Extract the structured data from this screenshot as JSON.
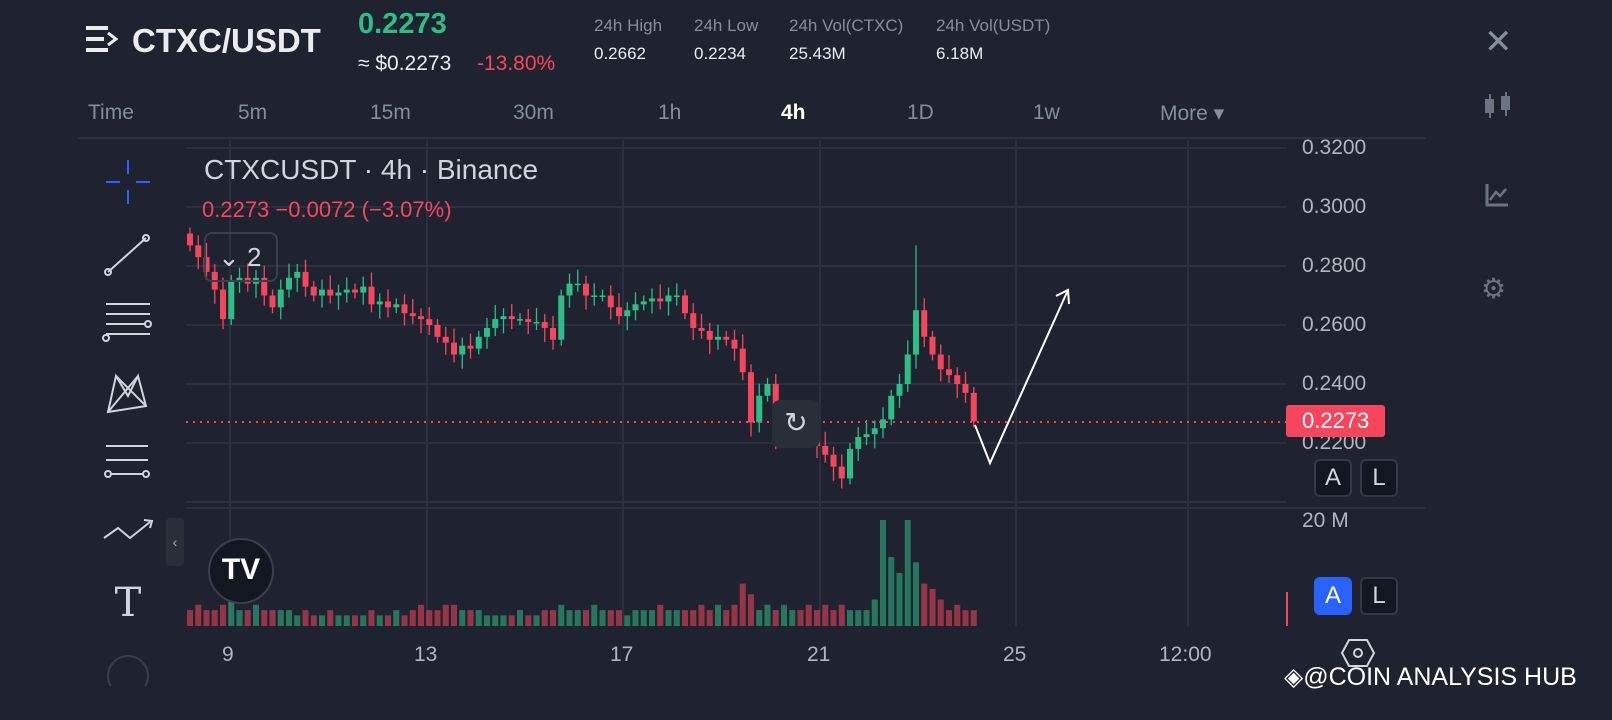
{
  "header": {
    "pair": "CTXC/USDT",
    "last_price": "0.2273",
    "usd_price": "≈ $0.2273",
    "change_pct": "-13.80%",
    "stats": [
      {
        "label": "24h High",
        "value": "0.2662"
      },
      {
        "label": "24h Low",
        "value": "0.2234"
      },
      {
        "label": "24h Vol(CTXC)",
        "value": "25.43M"
      },
      {
        "label": "24h Vol(USDT)",
        "value": "6.18M"
      }
    ]
  },
  "timeframes": [
    "Time",
    "5m",
    "15m",
    "30m",
    "1h",
    "4h",
    "1D",
    "1w",
    "More ▾"
  ],
  "active_timeframe": "4h",
  "legend": {
    "title": "CTXCUSDT · 4h · Binance",
    "values": "0.2273  −0.0072 (−3.07%)",
    "indicators_count": "2"
  },
  "price_axis": [
    "0.3200",
    "0.3000",
    "0.2800",
    "0.2600",
    "0.2400",
    "0.2200"
  ],
  "current_price_tag": "0.2273",
  "volume_axis": "20 M",
  "time_axis": [
    "9",
    "13",
    "17",
    "21",
    "25",
    "12:00"
  ],
  "buttons": {
    "auto": "A",
    "log": "L"
  },
  "watermark": "@COIN ANALYSIS HUB",
  "colors": {
    "up": "#2ebd85",
    "down": "#f6465d",
    "bg": "#1f2330"
  },
  "chart_data": {
    "type": "candlestick",
    "symbol": "CTXCUSDT",
    "interval": "4h",
    "ylim": [
      0.2,
      0.32
    ],
    "closes": [
      0.287,
      0.283,
      0.278,
      0.272,
      0.262,
      0.275,
      0.276,
      0.274,
      0.276,
      0.27,
      0.266,
      0.272,
      0.276,
      0.278,
      0.273,
      0.27,
      0.272,
      0.27,
      0.271,
      0.272,
      0.271,
      0.273,
      0.267,
      0.268,
      0.266,
      0.267,
      0.264,
      0.263,
      0.262,
      0.26,
      0.256,
      0.254,
      0.25,
      0.253,
      0.252,
      0.256,
      0.259,
      0.262,
      0.263,
      0.262,
      0.262,
      0.261,
      0.261,
      0.259,
      0.255,
      0.27,
      0.274,
      0.274,
      0.27,
      0.27,
      0.27,
      0.266,
      0.263,
      0.265,
      0.267,
      0.268,
      0.269,
      0.268,
      0.27,
      0.27,
      0.264,
      0.259,
      0.258,
      0.255,
      0.256,
      0.255,
      0.252,
      0.244,
      0.227,
      0.236,
      0.24,
      0.222,
      0.225,
      0.228,
      0.226,
      0.221,
      0.219,
      0.216,
      0.212,
      0.208,
      0.218,
      0.222,
      0.223,
      0.225,
      0.228,
      0.236,
      0.24,
      0.25,
      0.265,
      0.256,
      0.25,
      0.245,
      0.243,
      0.24,
      0.237,
      0.2273
    ],
    "volumes_m": [
      3,
      4,
      3,
      3,
      4,
      5,
      3,
      3,
      4,
      3,
      3,
      3,
      3,
      2,
      3,
      2,
      2,
      3,
      2,
      2,
      2,
      2,
      3,
      2,
      2,
      3,
      2,
      3,
      4,
      3,
      3,
      4,
      4,
      3,
      3,
      3,
      2,
      2,
      2,
      2,
      3,
      2,
      2,
      3,
      3,
      4,
      3,
      3,
      3,
      4,
      3,
      3,
      3,
      2,
      3,
      3,
      3,
      4,
      3,
      3,
      3,
      3,
      4,
      3,
      4,
      3,
      4,
      8,
      6,
      3,
      4,
      3,
      4,
      3,
      3,
      4,
      3,
      4,
      3,
      4,
      3,
      3,
      3,
      5,
      20,
      13,
      10,
      20,
      12,
      8,
      7,
      5,
      3,
      4,
      3,
      3
    ]
  }
}
